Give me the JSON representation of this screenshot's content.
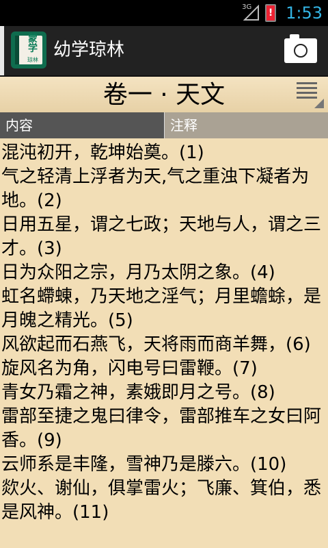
{
  "status_bar": {
    "network": "3G",
    "battery_alert": "!",
    "time": "1:53"
  },
  "action_bar": {
    "app_icon_line1": "蒙",
    "app_icon_line2": "学",
    "app_icon_line3": "琼林",
    "title": "幼学琼林"
  },
  "chapter": {
    "title": "卷一 · 天文"
  },
  "tabs": [
    {
      "label": "内容"
    },
    {
      "label": "注释"
    }
  ],
  "verses": [
    "混沌初开，乾坤始奠。(1)",
    "气之轻清上浮者为天,气之重浊下凝者为地。(2)",
    "日用五星，谓之七政；天地与人，谓之三才。(3)",
    "日为众阳之宗，月乃太阴之象。(4)",
    "虹名螮蝀，乃天地之淫气；月里蟾蜍，是月魄之精光。(5)",
    "风欲起而石燕飞，天将雨而商羊舞，(6)",
    "旋风名为角，闪电号曰雷鞭。(7)",
    "青女乃霜之神，素娥即月之号。(8)",
    "雷部至捷之鬼曰律令，雷部推车之女曰阿香。(9)",
    "云师系是丰隆，雪神乃是滕六。(10)",
    "欻火、谢仙，俱掌雷火；飞廉、箕伯，悉是风神。(11)"
  ]
}
